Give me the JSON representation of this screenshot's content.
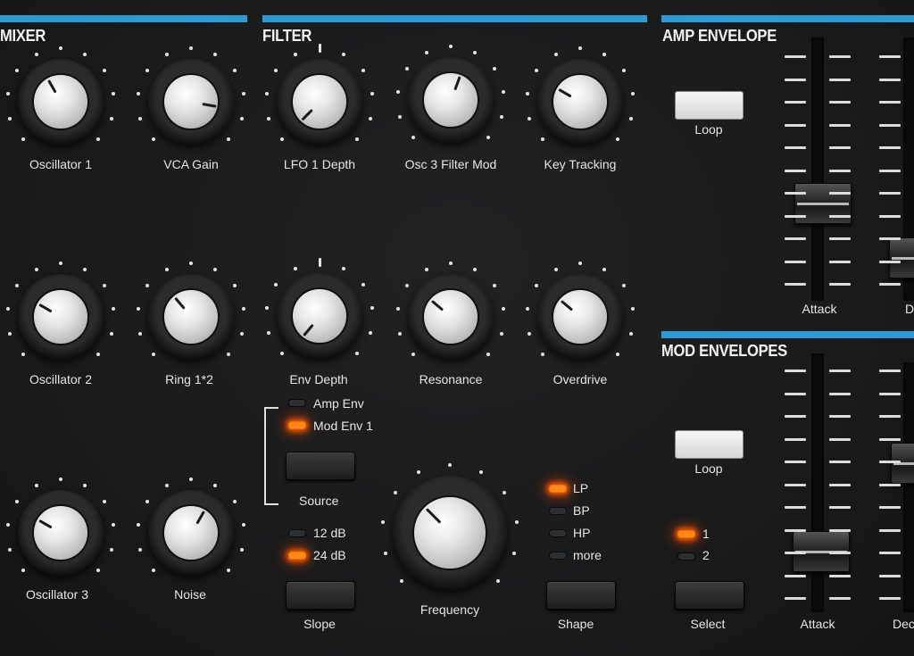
{
  "colors": {
    "section_bar": "#2a9ad8",
    "led_on": "#ff8a1a",
    "led_off": "#2c3033"
  },
  "sections": {
    "mixer": "MIXER",
    "filter": "FILTER",
    "amp_envelope": "AMP ENVELOPE",
    "mod_envelopes": "MOD ENVELOPES"
  },
  "mixer": {
    "oscillator1": "Oscillator 1",
    "vca_gain": "VCA Gain",
    "oscillator2": "Oscillator 2",
    "ring": "Ring 1*2",
    "oscillator3": "Oscillator 3",
    "noise": "Noise"
  },
  "filter": {
    "lfo1_depth": "LFO 1 Depth",
    "osc3_filter_mod": "Osc 3 Filter Mod",
    "key_tracking": "Key Tracking",
    "env_depth": "Env Depth",
    "resonance": "Resonance",
    "overdrive": "Overdrive",
    "source_options": [
      "Amp Env",
      "Mod Env 1"
    ],
    "source_label": "Source",
    "slope_options": [
      "12 dB",
      "24 dB"
    ],
    "slope_label": "Slope",
    "frequency": "Frequency",
    "shape_options": [
      "LP",
      "BP",
      "HP",
      "more"
    ],
    "shape_label": "Shape",
    "active_source": "Mod Env 1",
    "active_slope": "24 dB",
    "active_shape": "LP"
  },
  "amp_env": {
    "loop": "Loop",
    "attack": "Attack",
    "decay_partial": "Dec"
  },
  "mod_env": {
    "loop": "Loop",
    "select_options": [
      "1",
      "2"
    ],
    "select_label": "Select",
    "active_select": "1",
    "attack": "Attack",
    "decay_partial": "Dec"
  }
}
